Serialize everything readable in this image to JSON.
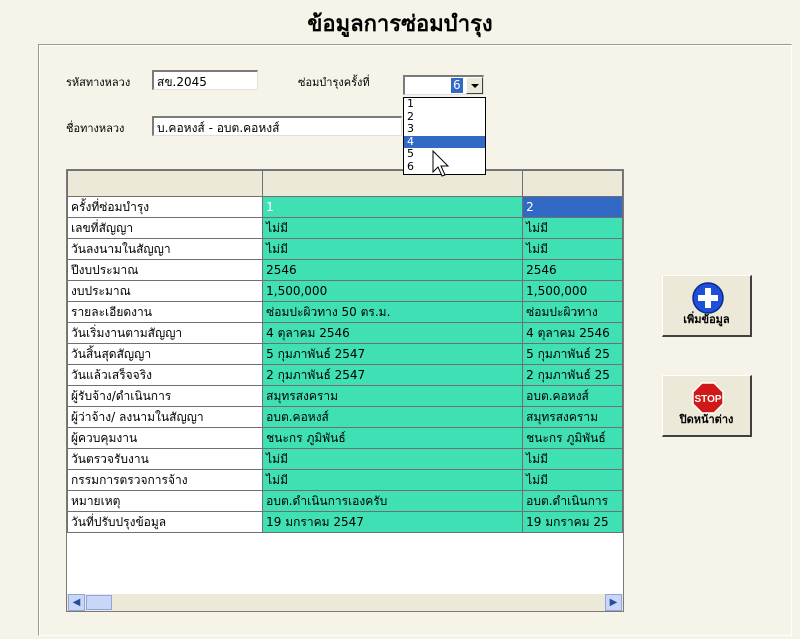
{
  "window": {
    "title": "ข้อมูลการซ่อมบำรุง"
  },
  "form": {
    "route_code_label": "รหัสทางหลวง",
    "route_code_value": "สข.2045",
    "repair_no_label": "ซ่อมบำรุงครั้งที่",
    "repair_no_value": "6",
    "route_name_label": "ชื่อทางหลวง",
    "route_name_value": "บ.คอหงส์ - อบต.คอหงส์"
  },
  "dropdown": {
    "options": [
      "1",
      "2",
      "3",
      "4",
      "5",
      "6"
    ],
    "highlighted": "4"
  },
  "grid": {
    "rows": [
      {
        "label": "ครั้งที่ซ่อมบำรุง",
        "c1": "1",
        "c2": "2"
      },
      {
        "label": "เลขที่สัญญา",
        "c1": "ไม่มี",
        "c2": "ไม่มี"
      },
      {
        "label": "วันลงนามในสัญญา",
        "c1": "ไม่มี",
        "c2": "ไม่มี"
      },
      {
        "label": "ปีงบประมาณ",
        "c1": "2546",
        "c2": "2546"
      },
      {
        "label": "งบประมาณ",
        "c1": "1,500,000",
        "c2": "1,500,000"
      },
      {
        "label": "รายละเอียดงาน",
        "c1": "ซ่อมปะผิวทาง 50 ตร.ม.",
        "c2": "ซ่อมปะผิวทาง"
      },
      {
        "label": "วันเริ่มงานตามสัญญา",
        "c1": "4 ตุลาคม 2546",
        "c2": "4 ตุลาคม 2546"
      },
      {
        "label": "วันสิ้นสุดสัญญา",
        "c1": "5 กุมภาพันธ์ 2547",
        "c2": "5 กุมภาพันธ์ 25"
      },
      {
        "label": "วันแล้วเสร็จจริง",
        "c1": "2 กุมภาพันธ์ 2547",
        "c2": "2 กุมภาพันธ์ 25"
      },
      {
        "label": "ผู้รับจ้าง/ดำเนินการ",
        "c1": "สมุทรสงคราม",
        "c2": "อบต.คอหงส์"
      },
      {
        "label": "ผู้ว่าจ้าง/ ลงนามในสัญญา",
        "c1": "อบต.คอหงส์",
        "c2": "สมุทรสงคราม"
      },
      {
        "label": "ผู้ควบคุมงาน",
        "c1": "ชนะกร ภูมิพันธ์",
        "c2": "ชนะกร ภูมิพันธ์"
      },
      {
        "label": "วันตรวจรับงาน",
        "c1": "ไม่มี",
        "c2": "ไม่มี"
      },
      {
        "label": "กรรมการตรวจการจ้าง",
        "c1": "ไม่มี",
        "c2": "ไม่มี"
      },
      {
        "label": "หมายเหตุ",
        "c1": "อบต.ดำเนินการเองครับ",
        "c2": "อบต.ดำเนินการ"
      },
      {
        "label": "วันที่ปรับปรุงข้อมูล",
        "c1": "19 มกราคม 2547",
        "c2": "19 มกราคม 25"
      }
    ]
  },
  "buttons": {
    "add_label": "เพิ่มข้อมูล",
    "close_label": "ปิดหน้าต่าง",
    "stop_sign_text": "STOP"
  },
  "colors": {
    "grid_cell": "#3ee0b4",
    "selection": "#316ac5",
    "add_icon": "#1e4fd8",
    "stop_icon": "#d01818"
  }
}
